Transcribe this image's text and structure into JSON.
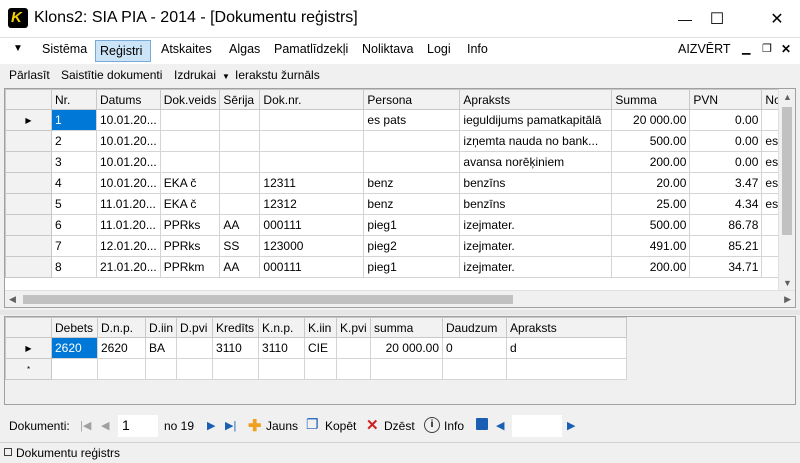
{
  "window": {
    "title": "Klons2: SIA PIA - 2014 - [Dokumentu reģistrs]",
    "minimize": "—",
    "maximize": "☐",
    "close": "✕"
  },
  "menu": {
    "items": [
      "Sistēma",
      "Reģistri",
      "Atskaites",
      "Algas",
      "Pamatlīdzekļi",
      "Noliktava",
      "Logi",
      "Info"
    ],
    "close_label": "AIZVĒRT"
  },
  "toolbar": {
    "items": [
      "Pārlasīt",
      "Saistītie dokumenti",
      "Izdrukai",
      "Ierakstu žurnāls"
    ]
  },
  "grid1": {
    "columns": [
      "Nr.",
      "Datums",
      "Dok.veids",
      "Sērija",
      "Dok.nr.",
      "Persona",
      "Apraksts",
      "Summa",
      "PVN",
      "Nor."
    ],
    "rows": [
      [
        "1",
        "10.01.20...",
        "",
        "",
        "",
        "es pats",
        "ieguldijums pamatkapitālā",
        "20 000.00",
        "0.00",
        ""
      ],
      [
        "2",
        "10.01.20...",
        "",
        "",
        "",
        "",
        "izņemta nauda no bank...",
        "500.00",
        "0.00",
        "es p"
      ],
      [
        "3",
        "10.01.20...",
        "",
        "",
        "",
        "",
        "avansa norēķiniem",
        "200.00",
        "0.00",
        "es p"
      ],
      [
        "4",
        "10.01.20...",
        "EKA č",
        "",
        "12311",
        "benz",
        "benzīns",
        "20.00",
        "3.47",
        "es p"
      ],
      [
        "5",
        "11.01.20...",
        "EKA č",
        "",
        "12312",
        "benz",
        "benzīns",
        "25.00",
        "4.34",
        "es p"
      ],
      [
        "6",
        "11.01.20...",
        "PPRks",
        "AA",
        "000111",
        "pieg1",
        "izejmater.",
        "500.00",
        "86.78",
        ""
      ],
      [
        "7",
        "12.01.20...",
        "PPRks",
        "SS",
        "123000",
        "pieg2",
        "izejmater.",
        "491.00",
        "85.21",
        ""
      ],
      [
        "8",
        "21.01.20...",
        "PPRkm",
        "AA",
        "000111",
        "pieg1",
        "izejmater.",
        "200.00",
        "34.71",
        ""
      ]
    ]
  },
  "grid2": {
    "columns": [
      "Debets",
      "D.n.p.",
      "D.iin",
      "D.pvi",
      "Kredīts",
      "K.n.p.",
      "K.iin",
      "K.pvi",
      "summa",
      "Daudzum",
      "Apraksts"
    ],
    "rows": [
      [
        "2620",
        "2620",
        "BA",
        "",
        "3110",
        "3110",
        "CIE",
        "",
        "20 000.00",
        "0",
        "d"
      ]
    ],
    "new_row_marker": "*"
  },
  "navigator": {
    "label": "Dokumenti:",
    "position": "1",
    "of_text": "no 19",
    "buttons": [
      "Jauns",
      "Kopēt",
      "Dzēst",
      "Info"
    ]
  },
  "bottom_tab": {
    "label": "Dokumentu reģistrs"
  },
  "colors": {
    "selection": "#0078d7",
    "menu_active": "#cce4f7",
    "delete_red": "#d02020",
    "nav_blue": "#1a5fb4",
    "add_yellow": "#f0a020"
  }
}
